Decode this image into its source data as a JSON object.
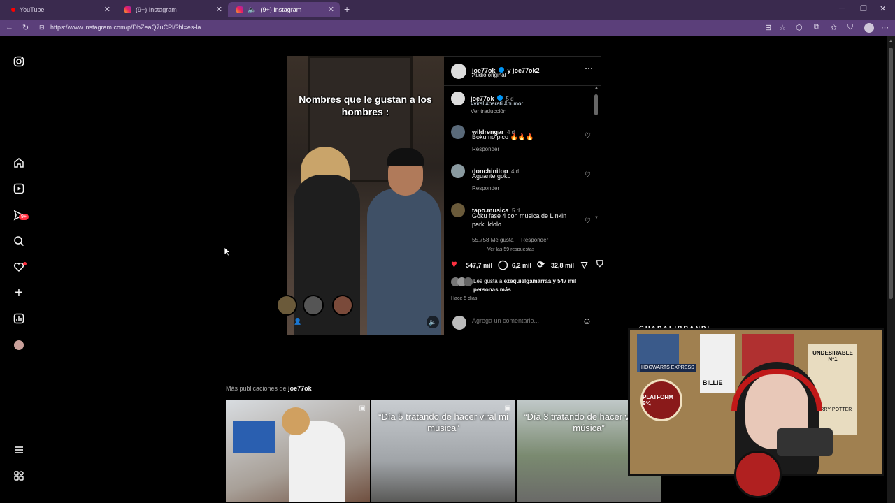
{
  "browser": {
    "tabs": [
      {
        "label": "YouTube",
        "active": false
      },
      {
        "label": "(9+) Instagram",
        "active": false
      },
      {
        "label": "(9+) Instagram",
        "active": true
      }
    ],
    "url": "https://www.instagram.com/p/DbZeaQ7uCPl/?hl=es-la"
  },
  "sidebar": {
    "notification_badge": "9+"
  },
  "post": {
    "caption_overlay": "Nombres que le gustan a los hombres :",
    "header_user": "joe77ok",
    "header_with": "y joe77ok2",
    "audio": "Audio original",
    "author": {
      "user": "joe77ok",
      "time": "5 d",
      "hashtags": "#viral #parati #humor",
      "translate": "Ver traducción"
    },
    "comments": [
      {
        "user": "wildrengar",
        "time": "4 d",
        "text": "Boku no pico 🔥🔥🔥",
        "reply": "Responder"
      },
      {
        "user": "donchinitoo",
        "time": "4 d",
        "text": "Aguante goku",
        "reply": "Responder"
      },
      {
        "user": "tapo.musica",
        "time": "5 d",
        "text": "Goku fase 4 con música de Linkin park. Ídolo",
        "likes": "55.758 Me gusta",
        "reply": "Responder"
      }
    ],
    "view_replies": "Ver las 59 respuestas",
    "stats": {
      "likes": "547,7 mil",
      "comments": "6,2 mil",
      "shares": "32,8 mil"
    },
    "liked_by_prefix": "Les gusta a",
    "liked_by_user": "ezequielgamarraa",
    "liked_by_rest": "y 547 mil personas más",
    "time_ago": "Hace 5 días",
    "comment_placeholder": "Agrega un comentario..."
  },
  "more": {
    "title_prefix": "Más publicaciones de",
    "title_user": "joe77ok",
    "thumbs": [
      {
        "text": ""
      },
      {
        "text": "“Día 5 tratando de hacer viral mi música”"
      },
      {
        "text": "“Día 3 tratando de hacer viral mi música”"
      }
    ]
  },
  "stream": {
    "name": "GUADALIBRANDI",
    "posters": [
      "HOGWARTS EXPRESS",
      "BILLIE",
      "PLATFORM 9¾",
      "UNDESIRABLE Nº1",
      "HARRY POTTER"
    ]
  }
}
